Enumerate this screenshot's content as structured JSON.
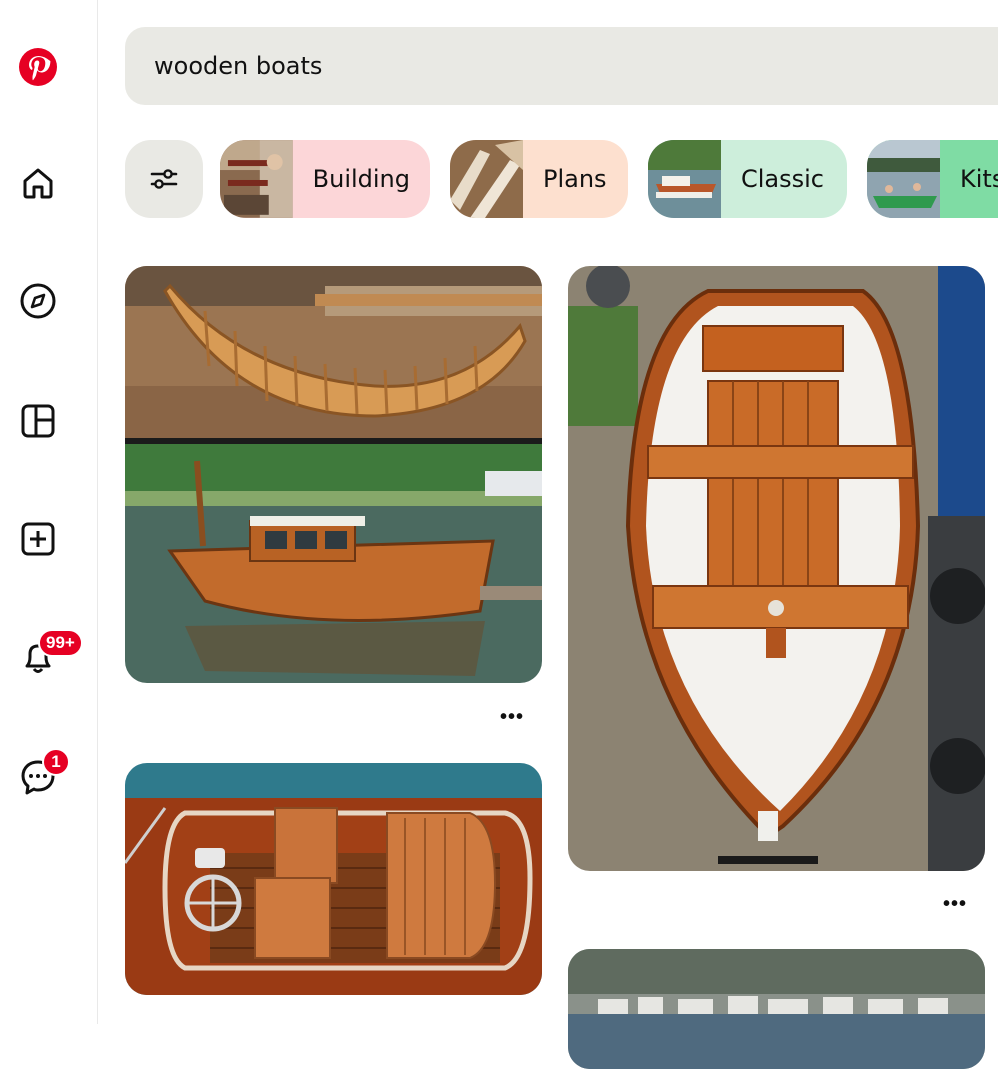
{
  "search": {
    "query": "wooden boats"
  },
  "sidebar": {
    "icons": [
      "pinterest-logo",
      "home-icon",
      "explore-icon",
      "dashboard-icon",
      "create-icon",
      "notifications-icon",
      "messages-icon"
    ],
    "notifications_badge": "99+",
    "messages_badge": "1"
  },
  "chips": [
    {
      "label": "Building",
      "bg": "#fcd6d8"
    },
    {
      "label": "Plans",
      "bg": "#fde0cf"
    },
    {
      "label": "Classic",
      "bg": "#cdeedb"
    },
    {
      "label": "Kits",
      "bg": "#7fdca4"
    }
  ],
  "pins": {
    "more_label": "•••"
  },
  "colors": {
    "brand": "#e60023",
    "search_bg": "#e9e9e4"
  }
}
